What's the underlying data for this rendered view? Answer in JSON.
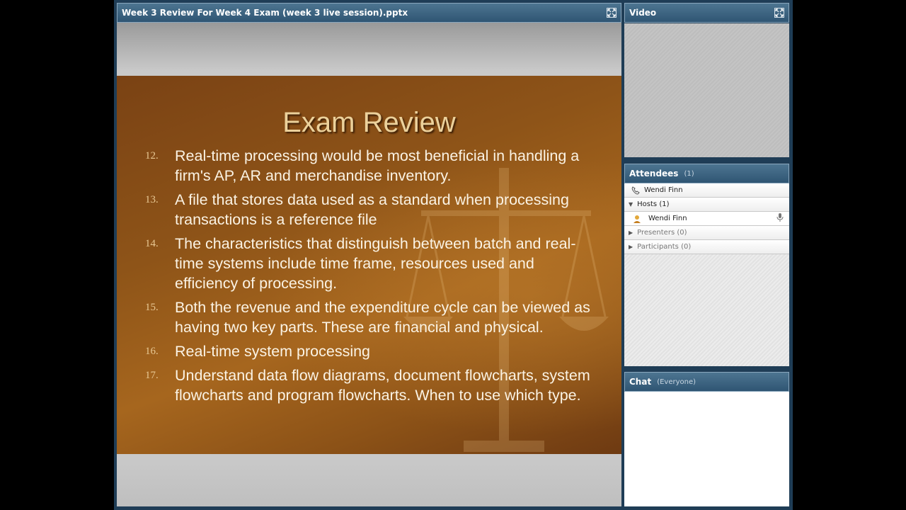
{
  "presentation": {
    "title": "Week 3 Review For Week 4 Exam (week 3 live session).pptx",
    "slide": {
      "heading": "Exam Review",
      "items": [
        {
          "num": "12.",
          "text": "Real-time processing would be most beneficial in handling a firm's AP, AR and merchandise inventory."
        },
        {
          "num": "13.",
          "text": "A file that stores data used as a standard when processing transactions is a reference file"
        },
        {
          "num": "14.",
          "text": "The characteristics that distinguish between batch and real-time systems include time frame, resources used and efficiency of processing."
        },
        {
          "num": "15.",
          "text": "Both the revenue and the expenditure cycle can be viewed as having two key parts. These are financial and physical."
        },
        {
          "num": "16.",
          "text": "Real-time system processing"
        },
        {
          "num": "17.",
          "text": "Understand data flow diagrams, document flowcharts, system flowcharts and program flowcharts.  When to use which type."
        }
      ]
    }
  },
  "video": {
    "title": "Video"
  },
  "attendees": {
    "title": "Attendees",
    "count": "(1)",
    "me": "Wendi Finn",
    "hosts_label": "Hosts (1)",
    "host_name": "Wendi Finn",
    "presenters_label": "Presenters (0)",
    "participants_label": "Participants (0)"
  },
  "chat": {
    "title": "Chat",
    "scope": "(Everyone)"
  },
  "icons": {
    "maximize": "maximize-icon",
    "phone": "phone-icon",
    "host": "host-badge-icon",
    "mic": "microphone-icon"
  }
}
